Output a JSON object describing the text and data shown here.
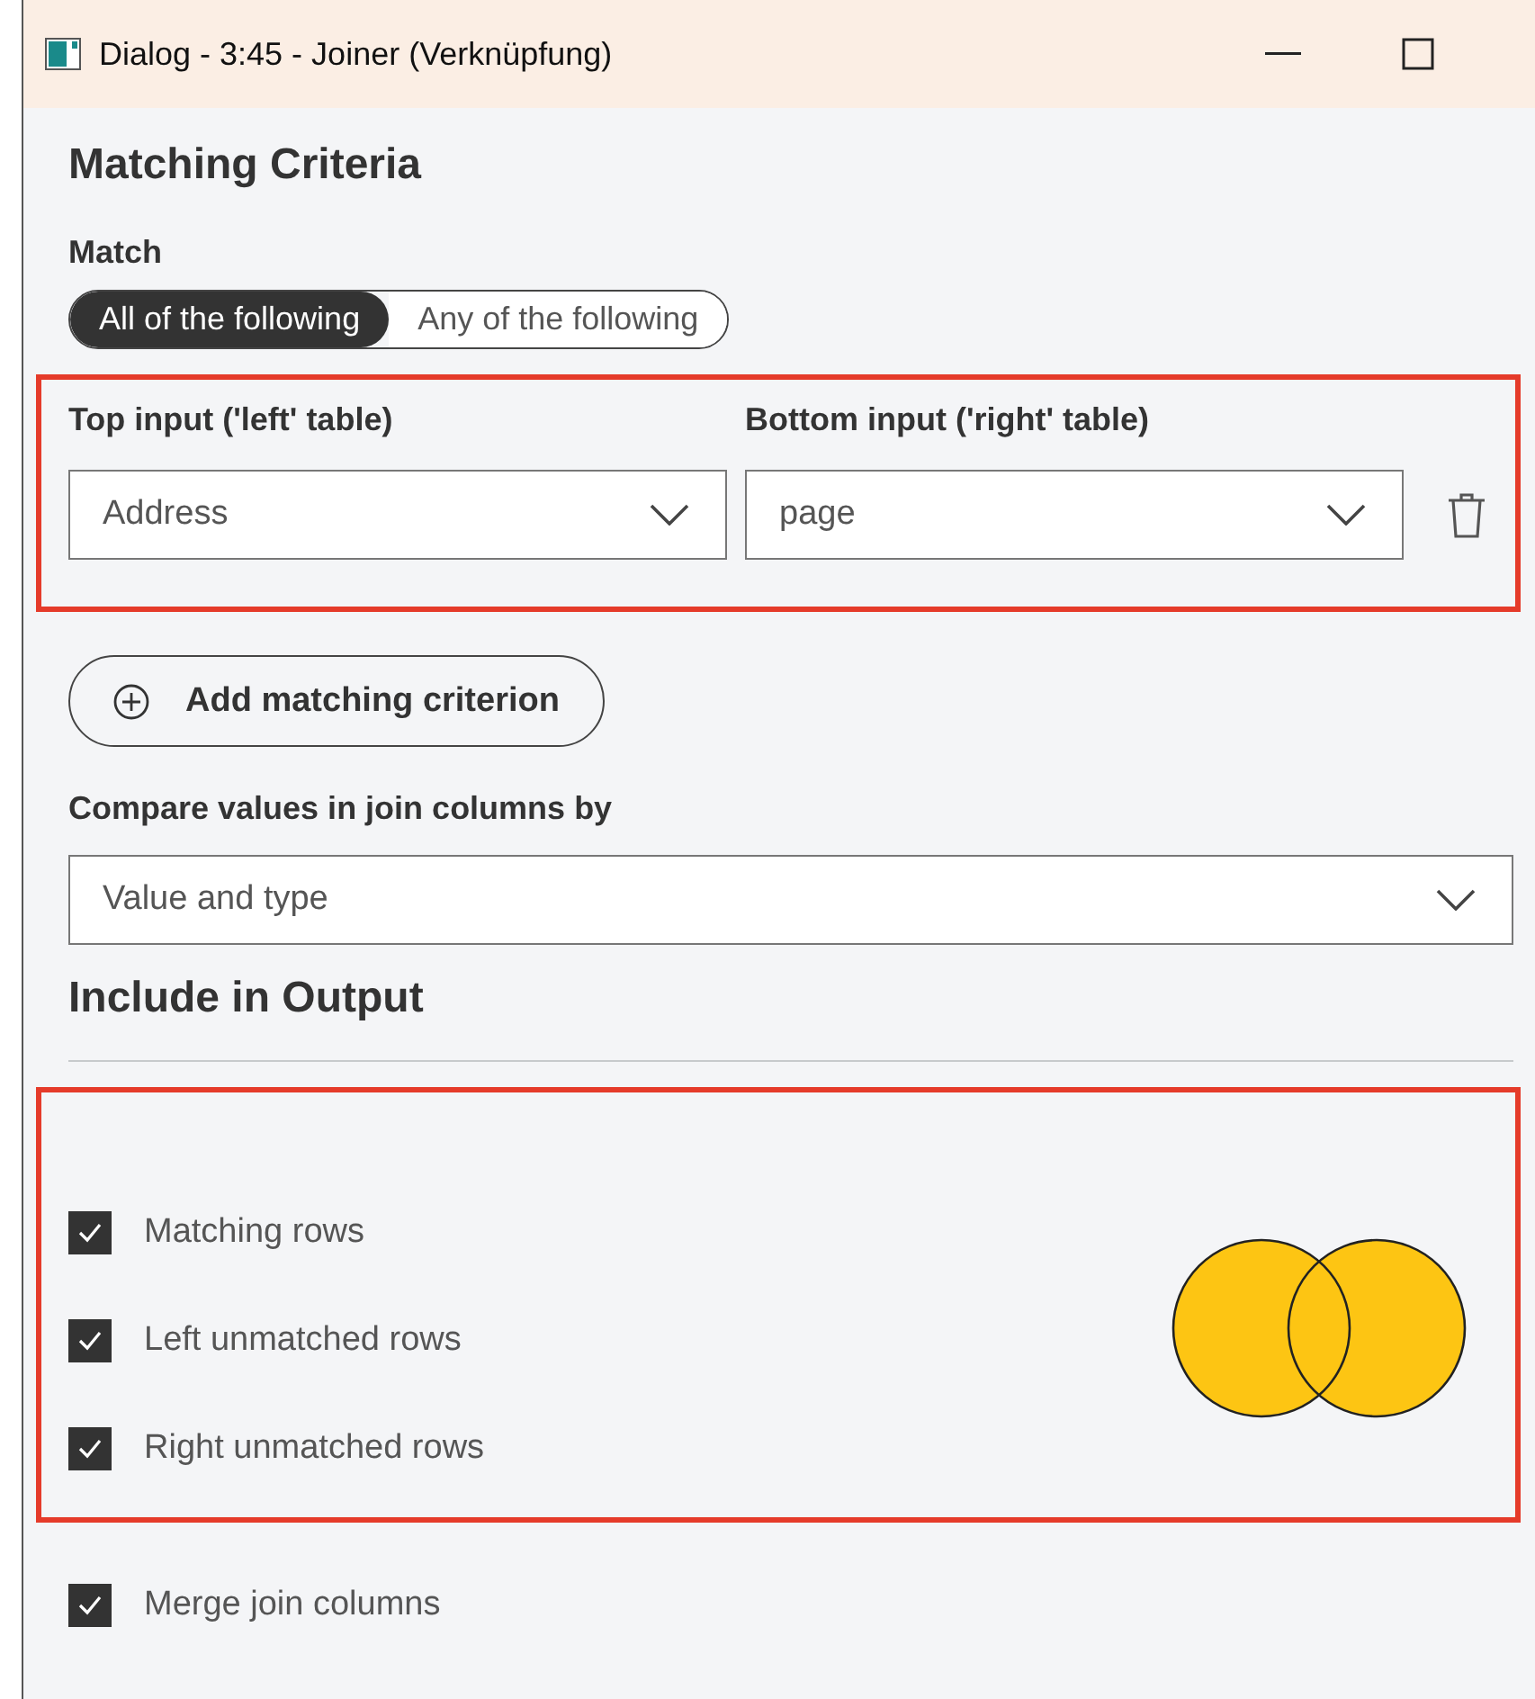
{
  "window": {
    "title": "Dialog - 3:45 - Joiner (Verknüpfung)"
  },
  "matching": {
    "heading": "Matching Criteria",
    "match_label": "Match",
    "match_options": [
      {
        "label": "All of the following",
        "selected": true
      },
      {
        "label": "Any of the following",
        "selected": false
      }
    ],
    "criteria": [
      {
        "left_label": "Top input ('left' table)",
        "right_label": "Bottom input ('right' table)",
        "left_value": "Address",
        "right_value": "page"
      }
    ],
    "add_button": "Add matching criterion",
    "compare_label": "Compare values in join columns by",
    "compare_value": "Value and type"
  },
  "output": {
    "heading": "Include in Output",
    "options": [
      {
        "kind": "matching",
        "label": "Matching rows",
        "checked": true
      },
      {
        "kind": "left",
        "label": "Left unmatched rows",
        "checked": true
      },
      {
        "kind": "right",
        "label": "Right unmatched rows",
        "checked": true
      }
    ],
    "merge": {
      "label": "Merge join columns",
      "checked": true
    }
  }
}
